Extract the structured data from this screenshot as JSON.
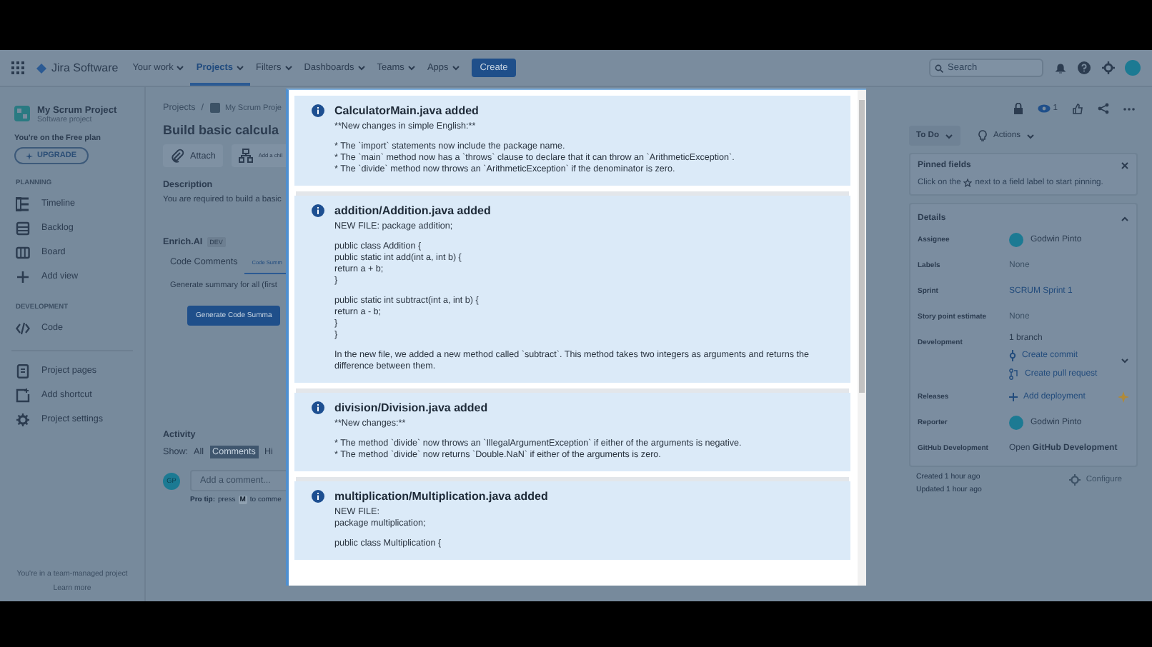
{
  "top_nav": {
    "logo": "Jira Software",
    "menu": [
      {
        "label": "Your work",
        "selected": false
      },
      {
        "label": "Projects",
        "selected": true
      },
      {
        "label": "Filters",
        "selected": false
      },
      {
        "label": "Dashboards",
        "selected": false
      },
      {
        "label": "Teams",
        "selected": false
      },
      {
        "label": "Apps",
        "selected": false
      }
    ],
    "create": "Create",
    "search": {
      "placeholder": "Search"
    }
  },
  "sidebar": {
    "project_name": "My Scrum Project",
    "project_type": "Software project",
    "plan_note": "You're on the Free plan",
    "upgrade": "UPGRADE",
    "sections": [
      {
        "heading": "PLANNING",
        "items": [
          {
            "label": "Timeline"
          },
          {
            "label": "Backlog"
          },
          {
            "label": "Board"
          },
          {
            "label": "Add view"
          }
        ]
      },
      {
        "heading": "DEVELOPMENT",
        "items": [
          {
            "label": "Code"
          }
        ]
      },
      {
        "items": [
          {
            "label": "Project pages"
          },
          {
            "label": "Add shortcut"
          },
          {
            "label": "Project settings"
          }
        ]
      }
    ],
    "footer": "You're in a team-managed project",
    "learn_more": "Learn more"
  },
  "issue": {
    "breadcrumbs": [
      "Projects",
      "My Scrum Proje"
    ],
    "breadcrumb_separator": "/",
    "title": "Build basic calcula",
    "actions": [
      {
        "label": "Attach"
      },
      {
        "label": "Add a chil"
      }
    ],
    "description_heading": "Description",
    "description": "You are required to build a basic",
    "app_name": "Enrich.AI",
    "app_badge": "DEV",
    "app_tabs": [
      {
        "label": "Code Comments",
        "selected": false
      },
      {
        "label": "Code Summ",
        "selected": true
      }
    ],
    "app_hint": "Generate summary for all (first",
    "generate_button": "Generate Code Summa",
    "activity": {
      "heading": "Activity",
      "show_label": "Show:",
      "filters": [
        {
          "label": "All",
          "selected": false
        },
        {
          "label": "Comments",
          "selected": true
        },
        {
          "label": "Hi",
          "selected": false
        }
      ],
      "avatar": "GP",
      "comment_placeholder": "Add a comment...",
      "pro_tip": "Pro tip:",
      "pro_tip_press": "press",
      "pro_tip_key": "M",
      "pro_tip_rest": "to comme"
    }
  },
  "side_panel": {
    "watchers": "1",
    "status": "To Do",
    "actions": "Actions",
    "pinned": {
      "title": "Pinned fields",
      "text_before": "Click on the",
      "text_after": "next to a field label to start pinning."
    },
    "details": {
      "title": "Details",
      "expanded": true,
      "rows": [
        {
          "kind": "person",
          "label": "Assignee",
          "value": "Godwin Pinto"
        },
        {
          "kind": "muted",
          "label": "Labels",
          "value": "None"
        },
        {
          "kind": "link",
          "label": "Sprint",
          "value": "SCRUM Sprint 1"
        },
        {
          "kind": "muted",
          "label": "Story point estimate",
          "value": "None"
        },
        {
          "kind": "development",
          "label": "Development",
          "value": "1 branch",
          "links": [
            "Create commit",
            "Create pull request"
          ]
        },
        {
          "kind": "add",
          "label": "Releases",
          "value": "Add deployment"
        },
        {
          "kind": "person",
          "label": "Reporter",
          "value": "Godwin Pinto"
        },
        {
          "kind": "rich",
          "label": "GitHub Development",
          "value": "Open **GitHub Development**"
        }
      ]
    },
    "created": "Created 1 hour ago",
    "updated": "Updated 1 hour ago",
    "configure": "Configure"
  },
  "modal": {
    "cards": [
      {
        "title": "CalculatorMain.java added",
        "paragraphs": [
          [
            "**New changes in simple English:**"
          ],
          [
            "* The `import` statements now include the package name.",
            "* The `main` method now has a `throws` clause to declare that it can throw an `ArithmeticException`.",
            "* The `divide` method now throws an `ArithmeticException` if the denominator is zero."
          ]
        ]
      },
      {
        "title": "addition/Addition.java added",
        "paragraphs": [
          [
            "NEW FILE: package addition;"
          ],
          [
            "public class Addition {",
            "public static int add(int a, int b) {",
            "return a + b;",
            "}"
          ],
          [
            "public static int subtract(int a, int b) {",
            "return a - b;",
            "}",
            "}"
          ],
          [
            "In the new file, we added a new method called `subtract`. This method takes two integers as arguments and returns the difference between them."
          ]
        ]
      },
      {
        "title": "division/Division.java added",
        "paragraphs": [
          [
            "**New changes:**"
          ],
          [
            "* The method `divide` now throws an `IllegalArgumentException` if either of the arguments is negative.",
            "* The method `divide` now returns `Double.NaN` if either of the arguments is zero."
          ]
        ]
      },
      {
        "title": "multiplication/Multiplication.java added",
        "paragraphs": [
          [
            "NEW FILE:",
            "package multiplication;"
          ],
          [
            "public class Multiplication {"
          ]
        ]
      }
    ]
  }
}
